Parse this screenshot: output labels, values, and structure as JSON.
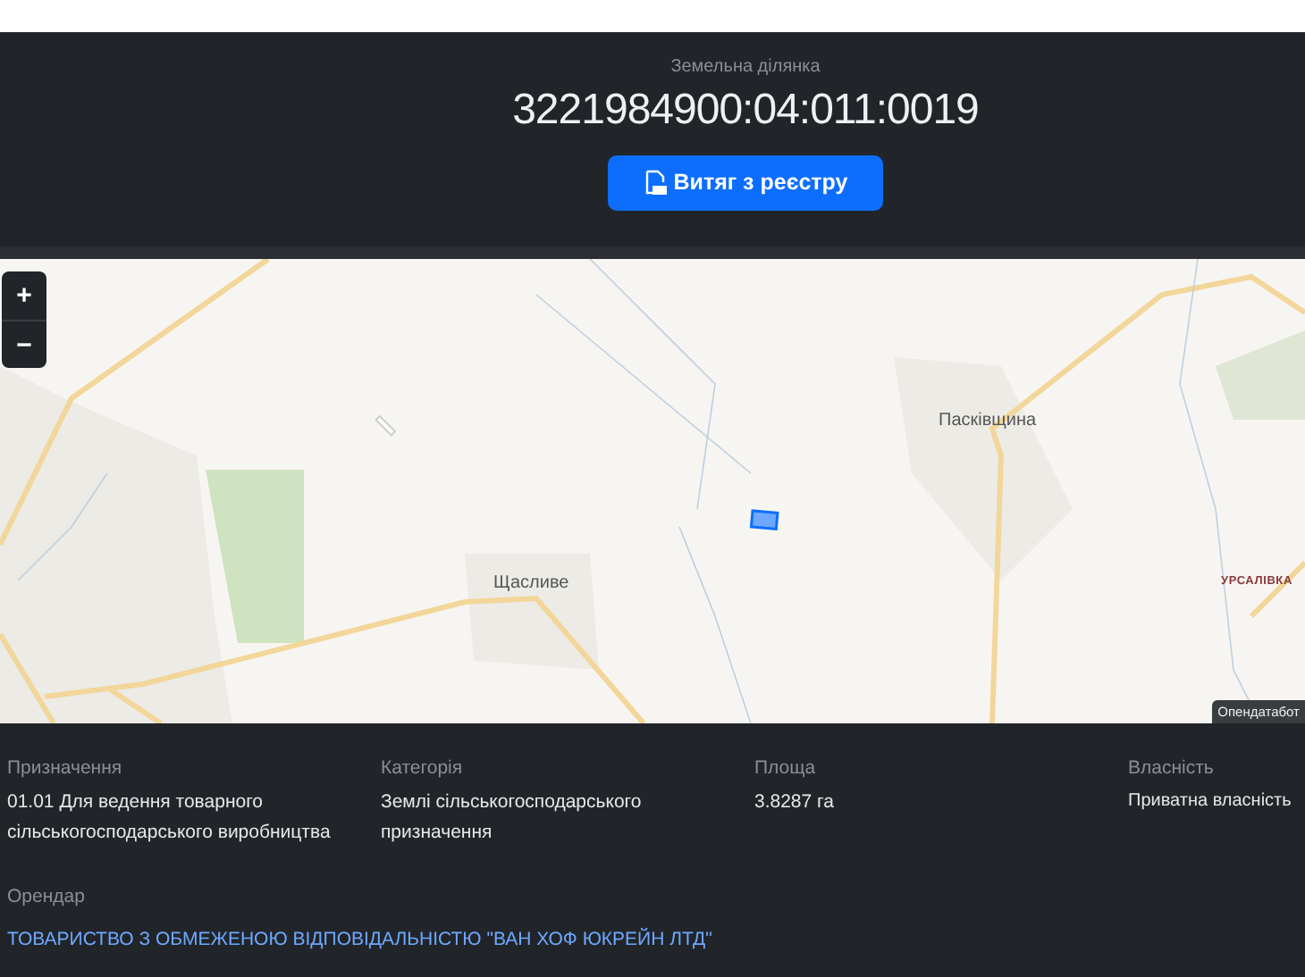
{
  "header": {
    "subtitle": "Земельна ділянка",
    "cadastral_number": "3221984900:04:011:0019",
    "extract_button": "Витяг з реєстру"
  },
  "map": {
    "zoom_in": "+",
    "zoom_out": "−",
    "place_labels": [
      {
        "text": "Щасливе",
        "kind": "village"
      },
      {
        "text": "Пасківщина",
        "kind": "village"
      },
      {
        "text": "УРСАЛІВКА",
        "kind": "district"
      }
    ],
    "attribution": "Опендатабот"
  },
  "details": [
    {
      "label": "Призначення",
      "value": "01.01 Для ведення товарного сільськогосподарського виробництва"
    },
    {
      "label": "Категорія",
      "value": "Землі сільськогосподарського призначення"
    },
    {
      "label": "Площа",
      "value": "3.8287 га"
    },
    {
      "label": "Власність",
      "value": "Приватна власність"
    }
  ],
  "tenant": {
    "label": "Орендар",
    "value": "ТОВАРИСТВО З ОБМЕЖЕНОЮ ВІДПОВІДАЛЬНІСТЮ \"ВАН ХОФ ЮКРЕЙН ЛТД\""
  }
}
